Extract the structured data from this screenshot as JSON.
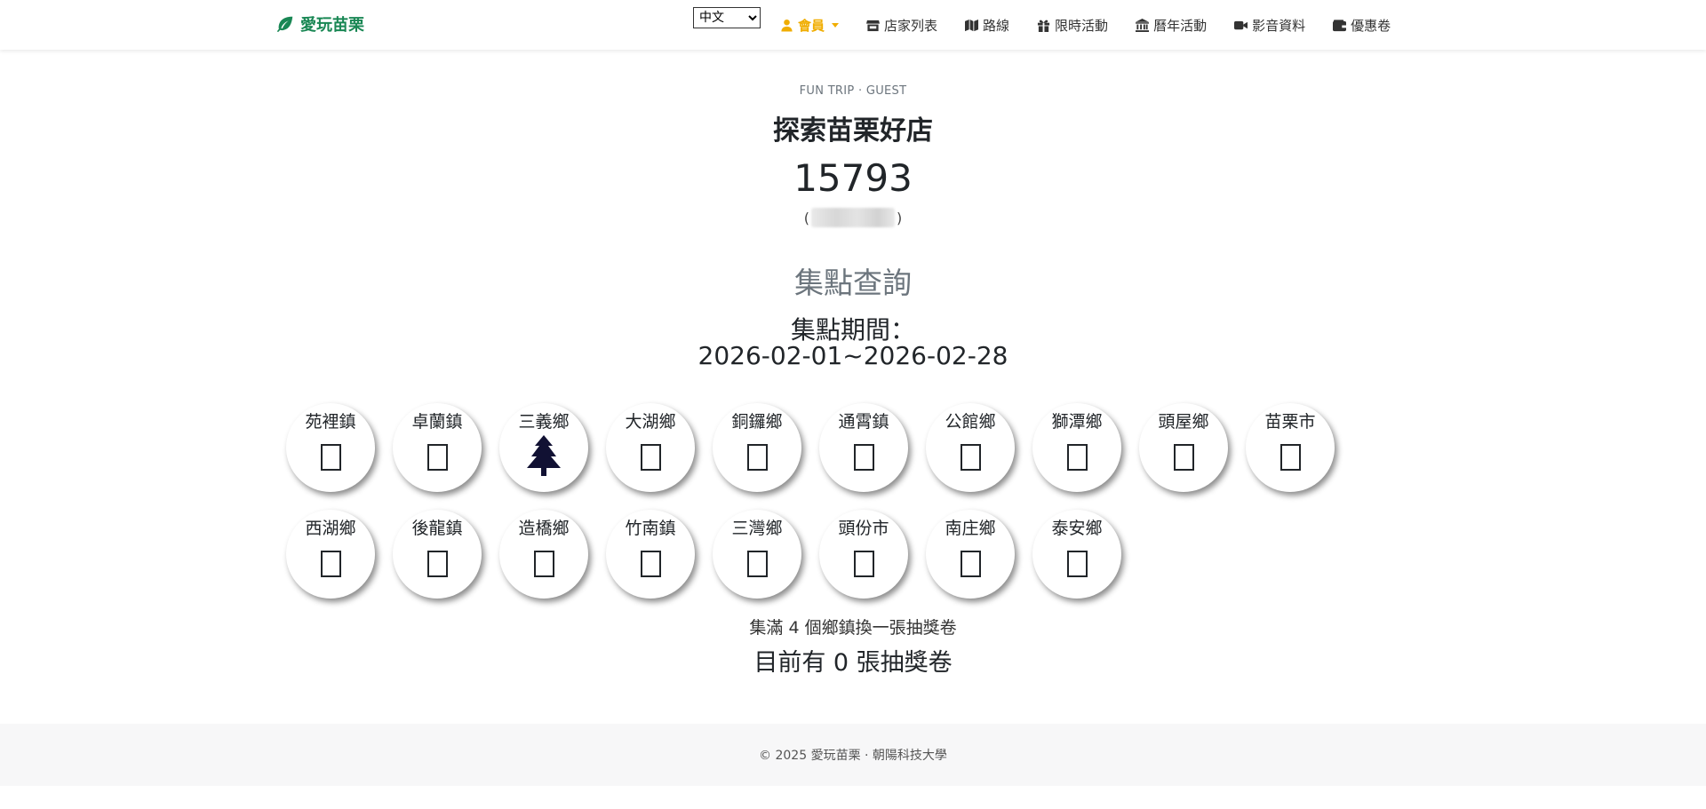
{
  "brand": {
    "name": "愛玩苗栗",
    "color": "#198754",
    "icon": "leaf-icon"
  },
  "language": {
    "selected": "中文",
    "options": [
      "中文"
    ]
  },
  "nav": {
    "member": {
      "label": "會員",
      "icon": "user-icon"
    },
    "items": [
      {
        "label": "店家列表",
        "icon": "store-icon"
      },
      {
        "label": "路線",
        "icon": "map-icon"
      },
      {
        "label": "限時活動",
        "icon": "gift-icon"
      },
      {
        "label": "曆年活動",
        "icon": "landmark-icon"
      },
      {
        "label": "影音資料",
        "icon": "video-icon"
      },
      {
        "label": "優惠卷",
        "icon": "wallet-icon"
      }
    ]
  },
  "hero": {
    "eyebrow": "FUN TRIP · GUEST",
    "title": "探索苗栗好店",
    "user_number": "15793",
    "user_id_open": "(",
    "user_id_close": ")"
  },
  "section": {
    "title": "集點查詢",
    "period_label": "集點期間：",
    "period_value": "2026-02-01~2026-02-28"
  },
  "stamps": [
    {
      "name": "苑裡鎮",
      "collected": false
    },
    {
      "name": "卓蘭鎮",
      "collected": false
    },
    {
      "name": "三義鄉",
      "collected": true,
      "icon": "tree-icon"
    },
    {
      "name": "大湖鄉",
      "collected": false
    },
    {
      "name": "銅鑼鄉",
      "collected": false
    },
    {
      "name": "通霄鎮",
      "collected": false
    },
    {
      "name": "公館鄉",
      "collected": false
    },
    {
      "name": "獅潭鄉",
      "collected": false
    },
    {
      "name": "頭屋鄉",
      "collected": false
    },
    {
      "name": "苗栗市",
      "collected": false
    },
    {
      "name": "西湖鄉",
      "collected": false
    },
    {
      "name": "後龍鎮",
      "collected": false
    },
    {
      "name": "造橋鄉",
      "collected": false
    },
    {
      "name": "竹南鎮",
      "collected": false
    },
    {
      "name": "三灣鄉",
      "collected": false
    },
    {
      "name": "頭份市",
      "collected": false
    },
    {
      "name": "南庄鄉",
      "collected": false
    },
    {
      "name": "泰安鄉",
      "collected": false
    }
  ],
  "rule_text": "集滿 4 個鄉鎮換一張抽獎卷",
  "tickets_text": "目前有 0 張抽獎卷",
  "footer": {
    "text": "© 2025 愛玩苗栗 · 朝陽科技大學"
  },
  "colors": {
    "member_accent": "#f0ad00",
    "tree": "#111133"
  }
}
